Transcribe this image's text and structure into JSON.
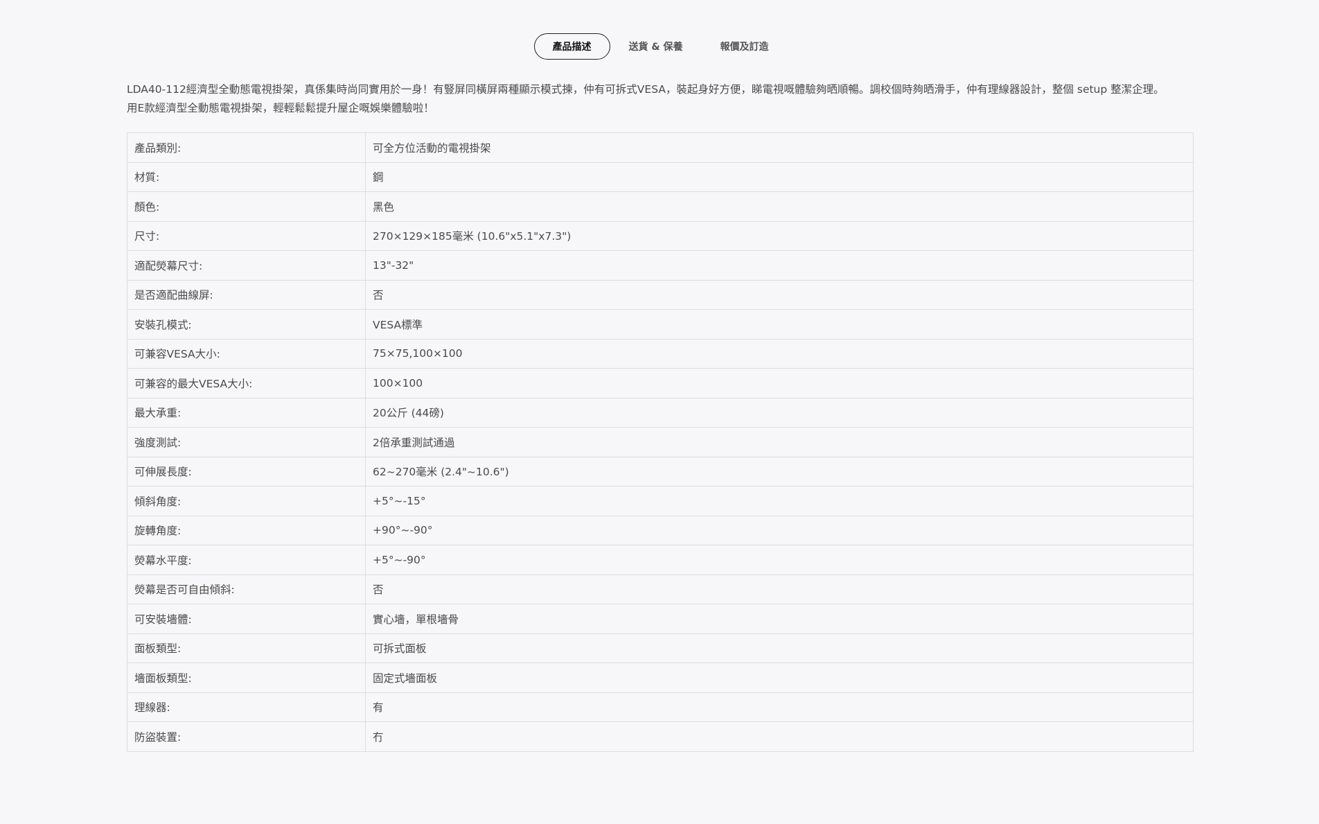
{
  "tabs": [
    {
      "label": "產品描述",
      "active": true
    },
    {
      "label": "送貨 & 保養",
      "active": false
    },
    {
      "label": "報價及訂造",
      "active": false
    }
  ],
  "description": {
    "line1": "LDA40-112經濟型全動態電視掛架，真係集時尚同實用於一身！有豎屏同橫屏兩種顯示模式揀，仲有可拆式VESA，裝起身好方便，睇電視嘅體驗夠晒順暢。調校個時夠晒滑手，仲有理線器設計，整個 setup 整潔企理。",
    "line2": "用E款經濟型全動態電視掛架，輕輕鬆鬆提升屋企嘅娛樂體驗啦！"
  },
  "specs": [
    {
      "label": "產品類別:",
      "value": "可全方位活動的電視掛架"
    },
    {
      "label": "材質:",
      "value": "鋼"
    },
    {
      "label": "顏色:",
      "value": "黑色"
    },
    {
      "label": "尺寸:",
      "value": "270×129×185毫米 (10.6\"x5.1\"x7.3\")"
    },
    {
      "label": "適配熒幕尺寸:",
      "value": "13\"-32\""
    },
    {
      "label": "是否適配曲線屏:",
      "value": "否"
    },
    {
      "label": "安裝孔模式:",
      "value": "VESA標準"
    },
    {
      "label": "可兼容VESA大小:",
      "value": "75×75,100×100"
    },
    {
      "label": "可兼容的最大VESA大小:",
      "value": "100×100"
    },
    {
      "label": "最大承重:",
      "value": "20公斤 (44磅)"
    },
    {
      "label": "強度測試:",
      "value": "2倍承重測試通過"
    },
    {
      "label": "可伸展長度:",
      "value": "62~270毫米 (2.4\"~10.6\")"
    },
    {
      "label": "傾斜角度:",
      "value": "+5°~-15°"
    },
    {
      "label": "旋轉角度:",
      "value": "+90°~-90°"
    },
    {
      "label": "熒幕水平度:",
      "value": "+5°~-90°"
    },
    {
      "label": "熒幕是否可自由傾斜:",
      "value": "否"
    },
    {
      "label": "可安裝墻體:",
      "value": "實心墻，單根墻骨"
    },
    {
      "label": "面板類型:",
      "value": "可拆式面板"
    },
    {
      "label": "墻面板類型:",
      "value": "固定式墻面板"
    },
    {
      "label": "理線器:",
      "value": "有"
    },
    {
      "label": "防盜裝置:",
      "value": "冇"
    }
  ]
}
